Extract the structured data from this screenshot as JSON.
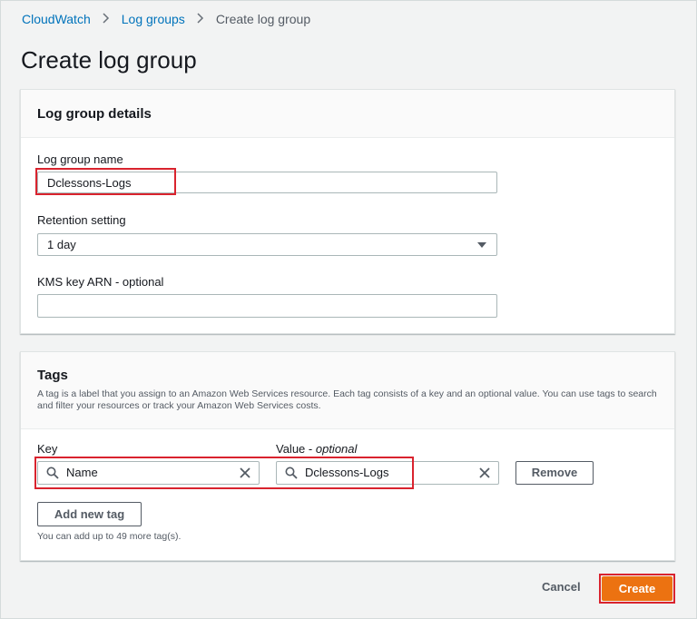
{
  "breadcrumb": {
    "items": [
      "CloudWatch",
      "Log groups"
    ],
    "current": "Create log group"
  },
  "page": {
    "title": "Create log group"
  },
  "details": {
    "title": "Log group details",
    "name_label": "Log group name",
    "name_value": "Dclessons-Logs",
    "retention_label": "Retention setting",
    "retention_value": "1 day",
    "kms_label": "KMS key ARN - optional",
    "kms_value": ""
  },
  "tags": {
    "title": "Tags",
    "description": "A tag is a label that you assign to an Amazon Web Services resource. Each tag consists of a key and an optional value. You can use tags to search and filter your resources or track your Amazon Web Services costs.",
    "key_label": "Key",
    "value_label": "Value",
    "value_label_suffix": "optional",
    "key_value": "Name",
    "value_value": "Dclessons-Logs",
    "remove_label": "Remove",
    "add_label": "Add new tag",
    "hint": "You can add up to 49 more tag(s)."
  },
  "footer": {
    "cancel_label": "Cancel",
    "create_label": "Create"
  },
  "colors": {
    "primary": "#ec7211",
    "link": "#0073bb",
    "highlight": "#d9232e"
  },
  "icons": {
    "separator": "chevron-right-icon",
    "search": "search-icon",
    "clear": "close-icon",
    "select": "caret-down-icon"
  }
}
